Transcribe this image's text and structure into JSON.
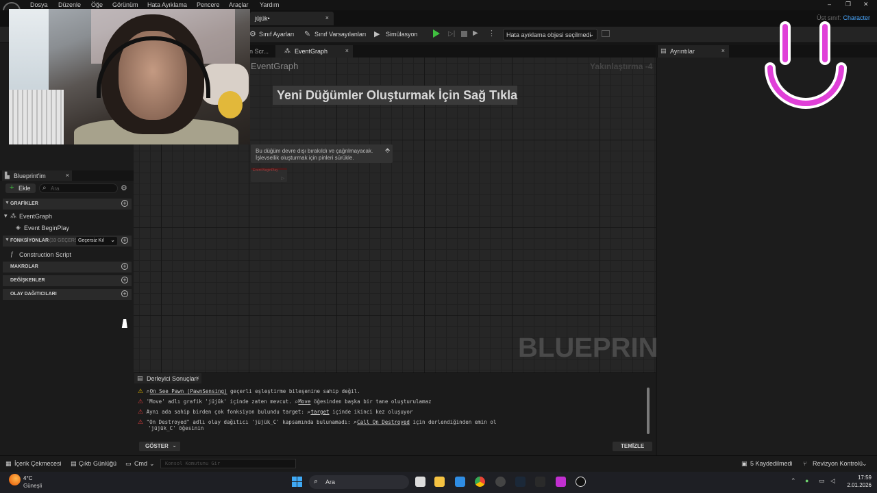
{
  "menu": {
    "items": [
      "Dosya",
      "Düzenle",
      "Öğe",
      "Görünüm",
      "Hata Ayıklama",
      "Pencere",
      "Araçlar",
      "Yardım"
    ]
  },
  "window_controls": {
    "minimize": "–",
    "restore": "❐",
    "close": "✕"
  },
  "doc_tab": {
    "title": "jüjük•",
    "close": "×"
  },
  "parent_class": {
    "label": "Üst sınıf:",
    "value": "Character"
  },
  "toolbar": {
    "class_settings": "Sınıf Ayarları",
    "class_defaults": "Sınıf Varsayılanları",
    "simulation": "Simülasyon",
    "debug_object": "Hata ayıklama objesi seçilmedi"
  },
  "blueprint_panel": {
    "tab_title": "Blueprint'im",
    "add_label": "Ekle",
    "search_placeholder": "Ara",
    "sections": {
      "graphs": "GRAFİKLER",
      "functions": "FONKSİYONLAR",
      "functions_count": "(33 GEÇERS",
      "override_label": "Geçersiz Kıl",
      "macros": "MAKROLAR",
      "variables": "DEĞİŞKENLER",
      "dispatchers": "OLAY DAĞITICILARI"
    },
    "items": {
      "event_graph": "EventGraph",
      "begin_play": "Event BeginPlay",
      "construction_script": "Construction Script"
    }
  },
  "graph": {
    "prev_tab": "n Scr...",
    "active_tab": "EventGraph",
    "breadcrumb": "EventGraph",
    "zoom": "Yakınlaştırma -4",
    "hint": "Yeni Düğümler Oluşturmak İçin Sağ Tıkla",
    "tooltip_line1": "Bu düğüm devre dışı bırakıldı ve çağrılmayacak.",
    "tooltip_line2": "İşlevsellik oluşturmak için pinleri sürükle.",
    "ghost_node_label": "Event BeginPlay",
    "watermark": "BLUEPRINT"
  },
  "details": {
    "tab_title": "Ayrıntılar"
  },
  "compiler": {
    "tab_title": "Derleyici Sonuçları",
    "messages": [
      {
        "severity": "warning",
        "link": "On See Pawn (PawnSensing)",
        "text": "geçerli eşleştirme bileşenine sahip değil."
      },
      {
        "severity": "error",
        "text": "'Move' adlı grafik 'jüjük' içinde zaten mevcut.",
        "link": "Move",
        "text2": "öğesinden başka bir tane oluşturulamaz"
      },
      {
        "severity": "error",
        "text": "Aynı ada sahip birden çok fonksiyon bulundu target:",
        "link": "target",
        "text2": "içinde ikinci kez oluşuyor"
      },
      {
        "severity": "error",
        "text": "\"On Destroyed\" adlı olay dağıtıcı 'jüjük_C' kapsamında bulunamadı:",
        "link": "Call On Destroyed",
        "text2": "için derlendiğinden emin ol",
        "text3": "'jüjük_C' öğesinin"
      }
    ],
    "show_label": "GÖSTER",
    "clear_label": "TEMİZLE"
  },
  "statusbar": {
    "content_drawer": "İçerik Çekmecesi",
    "output_log": "Çıktı Günlüğü",
    "cmd": "Cmd",
    "console_placeholder": "Konsol Komutunu Gir",
    "saved": "5 Kaydedilmedi",
    "revision": "Revizyon Kontrolü"
  },
  "taskbar": {
    "weather_temp": "4°C",
    "weather_desc": "Güneşli",
    "search": "Ara",
    "time": "17:59",
    "date": "2.01.2026"
  },
  "colors": {
    "accent_blue": "#4aa8ff",
    "play_green": "#3fbf3f",
    "warning": "#e6b800",
    "error": "#e04040",
    "smiley": "#e040d8"
  }
}
